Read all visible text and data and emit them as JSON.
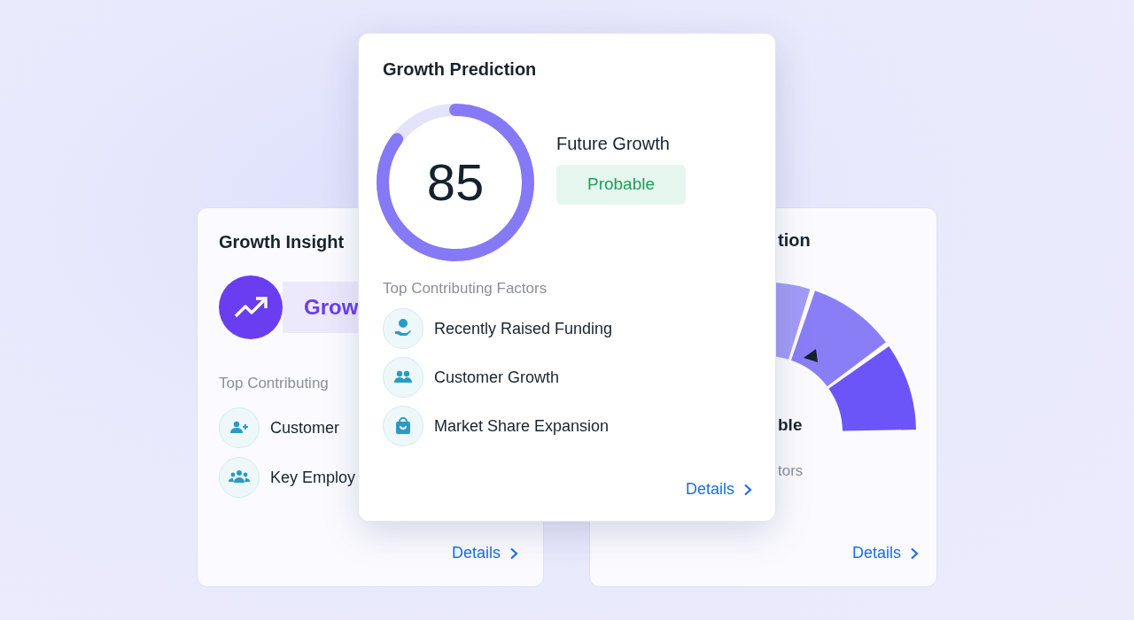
{
  "cards": [
    {
      "kind": "insight",
      "title": "Growth Insight",
      "highlight": "Grow",
      "factors_heading": "Top Contributing",
      "factors": [
        {
          "kind": "person-add",
          "label": "Customer"
        },
        {
          "kind": "team",
          "label": "Key Employ"
        }
      ],
      "link": "Details"
    },
    {
      "kind": "prediction",
      "title": "Growth Prediction",
      "score": "85",
      "level": 0.85,
      "status_label": "Future Growth",
      "status": "Probable",
      "factors_heading": "Top Contributing Factors",
      "factors": [
        {
          "kind": "funding",
          "label": "Recently Raised Funding"
        },
        {
          "kind": "people",
          "label": "Customer Growth"
        },
        {
          "kind": "bag",
          "label": "Market Share Expansion"
        }
      ],
      "link": "Details"
    },
    {
      "kind": "gauge",
      "title": "tion",
      "status": "ble",
      "factors_heading": "tors",
      "link": "Details"
    }
  ]
}
